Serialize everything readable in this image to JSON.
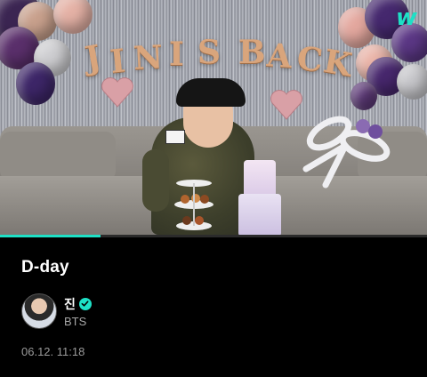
{
  "video": {
    "banner_letters": [
      "J",
      "I",
      "N",
      "I",
      "S",
      "B",
      "A",
      "C",
      "K"
    ],
    "progress_fraction": 0.235,
    "colors": {
      "progress": "#1ee0c6",
      "balloon_purple": "#4b2b72",
      "balloon_pink": "#e7b6ae"
    }
  },
  "app": {
    "logo_icon": "weverse-logo-icon",
    "logo_text": "w"
  },
  "post": {
    "title": "D-day",
    "author": {
      "name": "진",
      "group": "BTS",
      "verified_icon": "verified-check-icon"
    },
    "timestamp": "06.12. 11:18"
  }
}
